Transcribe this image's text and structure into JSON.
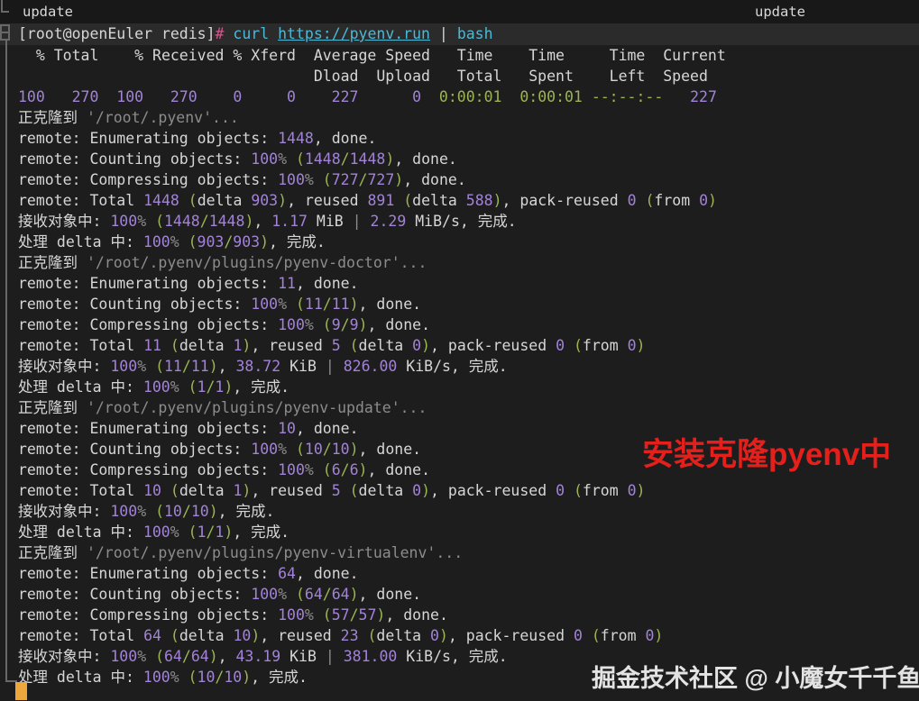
{
  "titlebar": {
    "left_title": "update",
    "right_title": "update"
  },
  "colors": {
    "background": "#1d1d1d",
    "titlebar_bg": "#181818",
    "prompt_row_bg": "#2b2b2b",
    "foreground": "#d6d6d6",
    "dim": "#8c8c8c",
    "number_purple": "#a283d8",
    "paren_green": "#9cb454",
    "command_cyan": "#4cb9d6",
    "hash_pink": "#d6568e",
    "red_watermark": "#e4201d",
    "cursor_orange": "#eda73c"
  },
  "prompt": {
    "segments": [
      [
        "[root@openEuler redis]",
        "fg"
      ],
      [
        "#",
        "pink"
      ],
      [
        " ",
        "fg"
      ],
      [
        "curl",
        "cyan"
      ],
      [
        " ",
        "fg"
      ],
      [
        "https://pyenv.run",
        "url"
      ],
      [
        " | ",
        "fg"
      ],
      [
        "bash",
        "cyan"
      ]
    ]
  },
  "terminal": {
    "lines": [
      [
        [
          "  % Total    % Received % Xferd  Average Speed   Time    Time     Time  Current",
          "fg"
        ]
      ],
      [
        [
          "                                 Dload  Upload   Total   Spent    Left  Speed",
          "fg"
        ]
      ],
      [
        [
          "100   270  100   270    0     0    227      0",
          "num"
        ],
        [
          "  ",
          "fg"
        ],
        [
          "0:00:01",
          "grn"
        ],
        [
          "  ",
          "fg"
        ],
        [
          "0:00:01",
          "grn"
        ],
        [
          " ",
          "fg"
        ],
        [
          "--:--:--",
          "grn"
        ],
        [
          "   ",
          "fg"
        ],
        [
          "227",
          "num"
        ]
      ],
      [
        [
          "正克隆到 ",
          "fg"
        ],
        [
          "'/root/.pyenv'...",
          "dim"
        ]
      ],
      [
        [
          "remote: Enumerating objects: ",
          "fg"
        ],
        [
          "1448",
          "num"
        ],
        [
          ", done.",
          "fg"
        ]
      ],
      [
        [
          "remote: Counting objects: ",
          "fg"
        ],
        [
          "100",
          "num"
        ],
        [
          "%",
          "dim"
        ],
        [
          " ",
          "fg"
        ],
        [
          "(",
          "grn"
        ],
        [
          "1448",
          "num"
        ],
        [
          "/",
          "grn"
        ],
        [
          "1448",
          "num"
        ],
        [
          ")",
          "grn"
        ],
        [
          ", done.",
          "fg"
        ]
      ],
      [
        [
          "remote: Compressing objects: ",
          "fg"
        ],
        [
          "100",
          "num"
        ],
        [
          "%",
          "dim"
        ],
        [
          " ",
          "fg"
        ],
        [
          "(",
          "grn"
        ],
        [
          "727",
          "num"
        ],
        [
          "/",
          "grn"
        ],
        [
          "727",
          "num"
        ],
        [
          ")",
          "grn"
        ],
        [
          ", done.",
          "fg"
        ]
      ],
      [
        [
          "remote: Total ",
          "fg"
        ],
        [
          "1448",
          "num"
        ],
        [
          " ",
          "fg"
        ],
        [
          "(",
          "grn"
        ],
        [
          "delta ",
          "fg"
        ],
        [
          "903",
          "num"
        ],
        [
          ")",
          "grn"
        ],
        [
          ", reused ",
          "fg"
        ],
        [
          "891",
          "num"
        ],
        [
          " ",
          "fg"
        ],
        [
          "(",
          "grn"
        ],
        [
          "delta ",
          "fg"
        ],
        [
          "588",
          "num"
        ],
        [
          ")",
          "grn"
        ],
        [
          ", pack-reused ",
          "fg"
        ],
        [
          "0",
          "num"
        ],
        [
          " ",
          "fg"
        ],
        [
          "(",
          "grn"
        ],
        [
          "from ",
          "fg"
        ],
        [
          "0",
          "num"
        ],
        [
          ")",
          "grn"
        ]
      ],
      [
        [
          "接收对象中: ",
          "fg"
        ],
        [
          "100",
          "num"
        ],
        [
          "%",
          "dim"
        ],
        [
          " ",
          "fg"
        ],
        [
          "(",
          "grn"
        ],
        [
          "1448",
          "num"
        ],
        [
          "/",
          "grn"
        ],
        [
          "1448",
          "num"
        ],
        [
          ")",
          "grn"
        ],
        [
          ", ",
          "fg"
        ],
        [
          "1.17",
          "num"
        ],
        [
          " MiB ",
          "fg"
        ],
        [
          "|",
          "dim"
        ],
        [
          " ",
          "fg"
        ],
        [
          "2.29",
          "num"
        ],
        [
          " MiB/s, 完成.",
          "fg"
        ]
      ],
      [
        [
          "处理 delta 中: ",
          "fg"
        ],
        [
          "100",
          "num"
        ],
        [
          "%",
          "dim"
        ],
        [
          " ",
          "fg"
        ],
        [
          "(",
          "grn"
        ],
        [
          "903",
          "num"
        ],
        [
          "/",
          "grn"
        ],
        [
          "903",
          "num"
        ],
        [
          ")",
          "grn"
        ],
        [
          ", 完成.",
          "fg"
        ]
      ],
      [
        [
          "正克隆到 ",
          "fg"
        ],
        [
          "'/root/.pyenv/plugins/pyenv-doctor'...",
          "dim"
        ]
      ],
      [
        [
          "remote: Enumerating objects: ",
          "fg"
        ],
        [
          "11",
          "num"
        ],
        [
          ", done.",
          "fg"
        ]
      ],
      [
        [
          "remote: Counting objects: ",
          "fg"
        ],
        [
          "100",
          "num"
        ],
        [
          "%",
          "dim"
        ],
        [
          " ",
          "fg"
        ],
        [
          "(",
          "grn"
        ],
        [
          "11",
          "num"
        ],
        [
          "/",
          "grn"
        ],
        [
          "11",
          "num"
        ],
        [
          ")",
          "grn"
        ],
        [
          ", done.",
          "fg"
        ]
      ],
      [
        [
          "remote: Compressing objects: ",
          "fg"
        ],
        [
          "100",
          "num"
        ],
        [
          "%",
          "dim"
        ],
        [
          " ",
          "fg"
        ],
        [
          "(",
          "grn"
        ],
        [
          "9",
          "num"
        ],
        [
          "/",
          "grn"
        ],
        [
          "9",
          "num"
        ],
        [
          ")",
          "grn"
        ],
        [
          ", done.",
          "fg"
        ]
      ],
      [
        [
          "remote: Total ",
          "fg"
        ],
        [
          "11",
          "num"
        ],
        [
          " ",
          "fg"
        ],
        [
          "(",
          "grn"
        ],
        [
          "delta ",
          "fg"
        ],
        [
          "1",
          "num"
        ],
        [
          ")",
          "grn"
        ],
        [
          ", reused ",
          "fg"
        ],
        [
          "5",
          "num"
        ],
        [
          " ",
          "fg"
        ],
        [
          "(",
          "grn"
        ],
        [
          "delta ",
          "fg"
        ],
        [
          "0",
          "num"
        ],
        [
          ")",
          "grn"
        ],
        [
          ", pack-reused ",
          "fg"
        ],
        [
          "0",
          "num"
        ],
        [
          " ",
          "fg"
        ],
        [
          "(",
          "grn"
        ],
        [
          "from ",
          "fg"
        ],
        [
          "0",
          "num"
        ],
        [
          ")",
          "grn"
        ]
      ],
      [
        [
          "接收对象中: ",
          "fg"
        ],
        [
          "100",
          "num"
        ],
        [
          "%",
          "dim"
        ],
        [
          " ",
          "fg"
        ],
        [
          "(",
          "grn"
        ],
        [
          "11",
          "num"
        ],
        [
          "/",
          "grn"
        ],
        [
          "11",
          "num"
        ],
        [
          ")",
          "grn"
        ],
        [
          ", ",
          "fg"
        ],
        [
          "38.72",
          "num"
        ],
        [
          " KiB ",
          "fg"
        ],
        [
          "|",
          "dim"
        ],
        [
          " ",
          "fg"
        ],
        [
          "826.00",
          "num"
        ],
        [
          " KiB/s, 完成.",
          "fg"
        ]
      ],
      [
        [
          "处理 delta 中: ",
          "fg"
        ],
        [
          "100",
          "num"
        ],
        [
          "%",
          "dim"
        ],
        [
          " ",
          "fg"
        ],
        [
          "(",
          "grn"
        ],
        [
          "1",
          "num"
        ],
        [
          "/",
          "grn"
        ],
        [
          "1",
          "num"
        ],
        [
          ")",
          "grn"
        ],
        [
          ", 完成.",
          "fg"
        ]
      ],
      [
        [
          "正克隆到 ",
          "fg"
        ],
        [
          "'/root/.pyenv/plugins/pyenv-update'...",
          "dim"
        ]
      ],
      [
        [
          "remote: Enumerating objects: ",
          "fg"
        ],
        [
          "10",
          "num"
        ],
        [
          ", done.",
          "fg"
        ]
      ],
      [
        [
          "remote: Counting objects: ",
          "fg"
        ],
        [
          "100",
          "num"
        ],
        [
          "%",
          "dim"
        ],
        [
          " ",
          "fg"
        ],
        [
          "(",
          "grn"
        ],
        [
          "10",
          "num"
        ],
        [
          "/",
          "grn"
        ],
        [
          "10",
          "num"
        ],
        [
          ")",
          "grn"
        ],
        [
          ", done.",
          "fg"
        ]
      ],
      [
        [
          "remote: Compressing objects: ",
          "fg"
        ],
        [
          "100",
          "num"
        ],
        [
          "%",
          "dim"
        ],
        [
          " ",
          "fg"
        ],
        [
          "(",
          "grn"
        ],
        [
          "6",
          "num"
        ],
        [
          "/",
          "grn"
        ],
        [
          "6",
          "num"
        ],
        [
          ")",
          "grn"
        ],
        [
          ", done.",
          "fg"
        ]
      ],
      [
        [
          "remote: Total ",
          "fg"
        ],
        [
          "10",
          "num"
        ],
        [
          " ",
          "fg"
        ],
        [
          "(",
          "grn"
        ],
        [
          "delta ",
          "fg"
        ],
        [
          "1",
          "num"
        ],
        [
          ")",
          "grn"
        ],
        [
          ", reused ",
          "fg"
        ],
        [
          "5",
          "num"
        ],
        [
          " ",
          "fg"
        ],
        [
          "(",
          "grn"
        ],
        [
          "delta ",
          "fg"
        ],
        [
          "0",
          "num"
        ],
        [
          ")",
          "grn"
        ],
        [
          ", pack-reused ",
          "fg"
        ],
        [
          "0",
          "num"
        ],
        [
          " ",
          "fg"
        ],
        [
          "(",
          "grn"
        ],
        [
          "from ",
          "fg"
        ],
        [
          "0",
          "num"
        ],
        [
          ")",
          "grn"
        ]
      ],
      [
        [
          "接收对象中: ",
          "fg"
        ],
        [
          "100",
          "num"
        ],
        [
          "%",
          "dim"
        ],
        [
          " ",
          "fg"
        ],
        [
          "(",
          "grn"
        ],
        [
          "10",
          "num"
        ],
        [
          "/",
          "grn"
        ],
        [
          "10",
          "num"
        ],
        [
          ")",
          "grn"
        ],
        [
          ", 完成.",
          "fg"
        ]
      ],
      [
        [
          "处理 delta 中: ",
          "fg"
        ],
        [
          "100",
          "num"
        ],
        [
          "%",
          "dim"
        ],
        [
          " ",
          "fg"
        ],
        [
          "(",
          "grn"
        ],
        [
          "1",
          "num"
        ],
        [
          "/",
          "grn"
        ],
        [
          "1",
          "num"
        ],
        [
          ")",
          "grn"
        ],
        [
          ", 完成.",
          "fg"
        ]
      ],
      [
        [
          "正克隆到 ",
          "fg"
        ],
        [
          "'/root/.pyenv/plugins/pyenv-virtualenv'...",
          "dim"
        ]
      ],
      [
        [
          "remote: Enumerating objects: ",
          "fg"
        ],
        [
          "64",
          "num"
        ],
        [
          ", done.",
          "fg"
        ]
      ],
      [
        [
          "remote: Counting objects: ",
          "fg"
        ],
        [
          "100",
          "num"
        ],
        [
          "%",
          "dim"
        ],
        [
          " ",
          "fg"
        ],
        [
          "(",
          "grn"
        ],
        [
          "64",
          "num"
        ],
        [
          "/",
          "grn"
        ],
        [
          "64",
          "num"
        ],
        [
          ")",
          "grn"
        ],
        [
          ", done.",
          "fg"
        ]
      ],
      [
        [
          "remote: Compressing objects: ",
          "fg"
        ],
        [
          "100",
          "num"
        ],
        [
          "%",
          "dim"
        ],
        [
          " ",
          "fg"
        ],
        [
          "(",
          "grn"
        ],
        [
          "57",
          "num"
        ],
        [
          "/",
          "grn"
        ],
        [
          "57",
          "num"
        ],
        [
          ")",
          "grn"
        ],
        [
          ", done.",
          "fg"
        ]
      ],
      [
        [
          "remote: Total ",
          "fg"
        ],
        [
          "64",
          "num"
        ],
        [
          " ",
          "fg"
        ],
        [
          "(",
          "grn"
        ],
        [
          "delta ",
          "fg"
        ],
        [
          "10",
          "num"
        ],
        [
          ")",
          "grn"
        ],
        [
          ", reused ",
          "fg"
        ],
        [
          "23",
          "num"
        ],
        [
          " ",
          "fg"
        ],
        [
          "(",
          "grn"
        ],
        [
          "delta ",
          "fg"
        ],
        [
          "0",
          "num"
        ],
        [
          ")",
          "grn"
        ],
        [
          ", pack-reused ",
          "fg"
        ],
        [
          "0",
          "num"
        ],
        [
          " ",
          "fg"
        ],
        [
          "(",
          "grn"
        ],
        [
          "from ",
          "fg"
        ],
        [
          "0",
          "num"
        ],
        [
          ")",
          "grn"
        ]
      ],
      [
        [
          "接收对象中: ",
          "fg"
        ],
        [
          "100",
          "num"
        ],
        [
          "%",
          "dim"
        ],
        [
          " ",
          "fg"
        ],
        [
          "(",
          "grn"
        ],
        [
          "64",
          "num"
        ],
        [
          "/",
          "grn"
        ],
        [
          "64",
          "num"
        ],
        [
          ")",
          "grn"
        ],
        [
          ", ",
          "fg"
        ],
        [
          "43.19",
          "num"
        ],
        [
          " KiB ",
          "fg"
        ],
        [
          "|",
          "dim"
        ],
        [
          " ",
          "fg"
        ],
        [
          "381.00",
          "num"
        ],
        [
          " KiB/s, 完成.",
          "fg"
        ]
      ],
      [
        [
          "处理 delta 中: ",
          "fg"
        ],
        [
          "100",
          "num"
        ],
        [
          "%",
          "dim"
        ],
        [
          " ",
          "fg"
        ],
        [
          "(",
          "grn"
        ],
        [
          "10",
          "num"
        ],
        [
          "/",
          "grn"
        ],
        [
          "10",
          "num"
        ],
        [
          ")",
          "grn"
        ],
        [
          ", 完成.",
          "fg"
        ]
      ]
    ]
  },
  "overlays": {
    "red_watermark": "安装克隆pyenv中",
    "bottom_watermark": "掘金技术社区 @ 小魔女千千鱼"
  }
}
